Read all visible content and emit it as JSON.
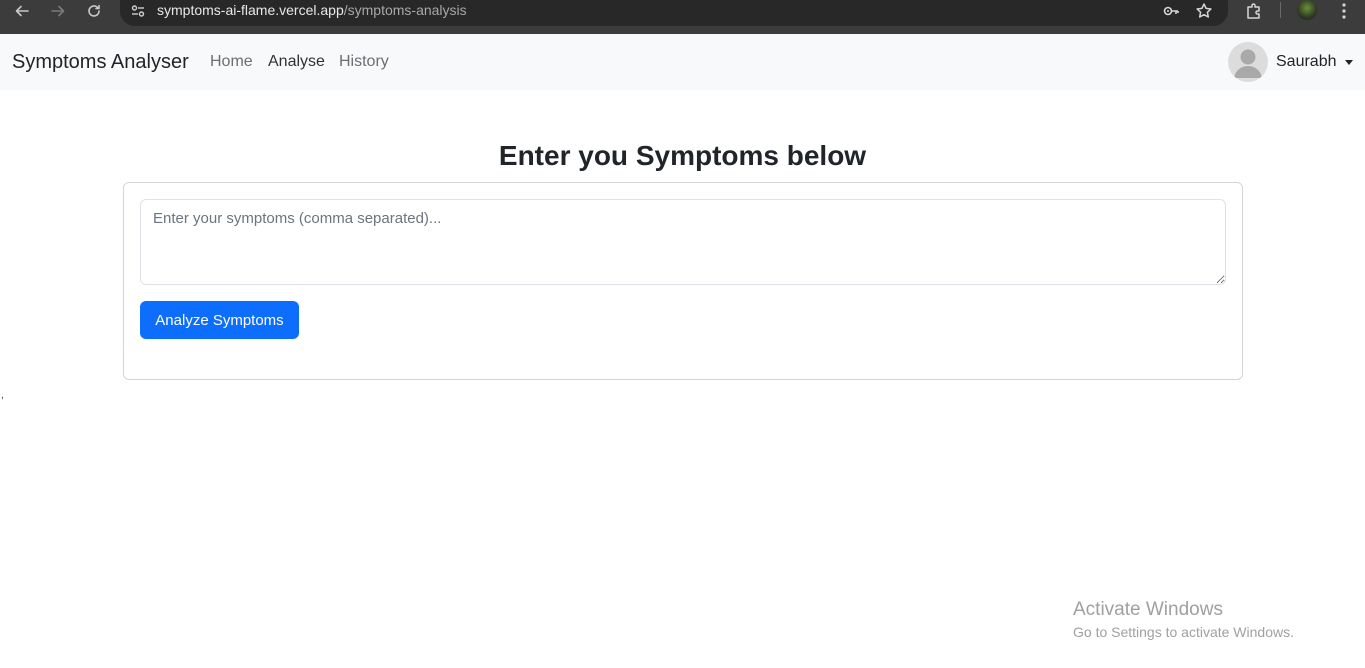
{
  "browser": {
    "url_host": "symptoms-ai-flame.vercel.app",
    "url_path": "/symptoms-analysis"
  },
  "navbar": {
    "brand": "Symptoms Analyser",
    "links": [
      {
        "label": "Home"
      },
      {
        "label": "Analyse"
      },
      {
        "label": "History"
      }
    ],
    "user_name": "Saurabh"
  },
  "main": {
    "title": "Enter you Symptoms below",
    "input": {
      "placeholder": "Enter your symptoms (comma separated)...",
      "value": ""
    },
    "button_label": "Analyze Symptoms",
    "stray_mark": ","
  },
  "watermark": {
    "title": "Activate Windows",
    "subtitle": "Go to Settings to activate Windows."
  },
  "colors": {
    "primary": "#0d6efd",
    "navbar_bg": "#f8f9fa",
    "chrome_bg": "#3c3c3c"
  }
}
